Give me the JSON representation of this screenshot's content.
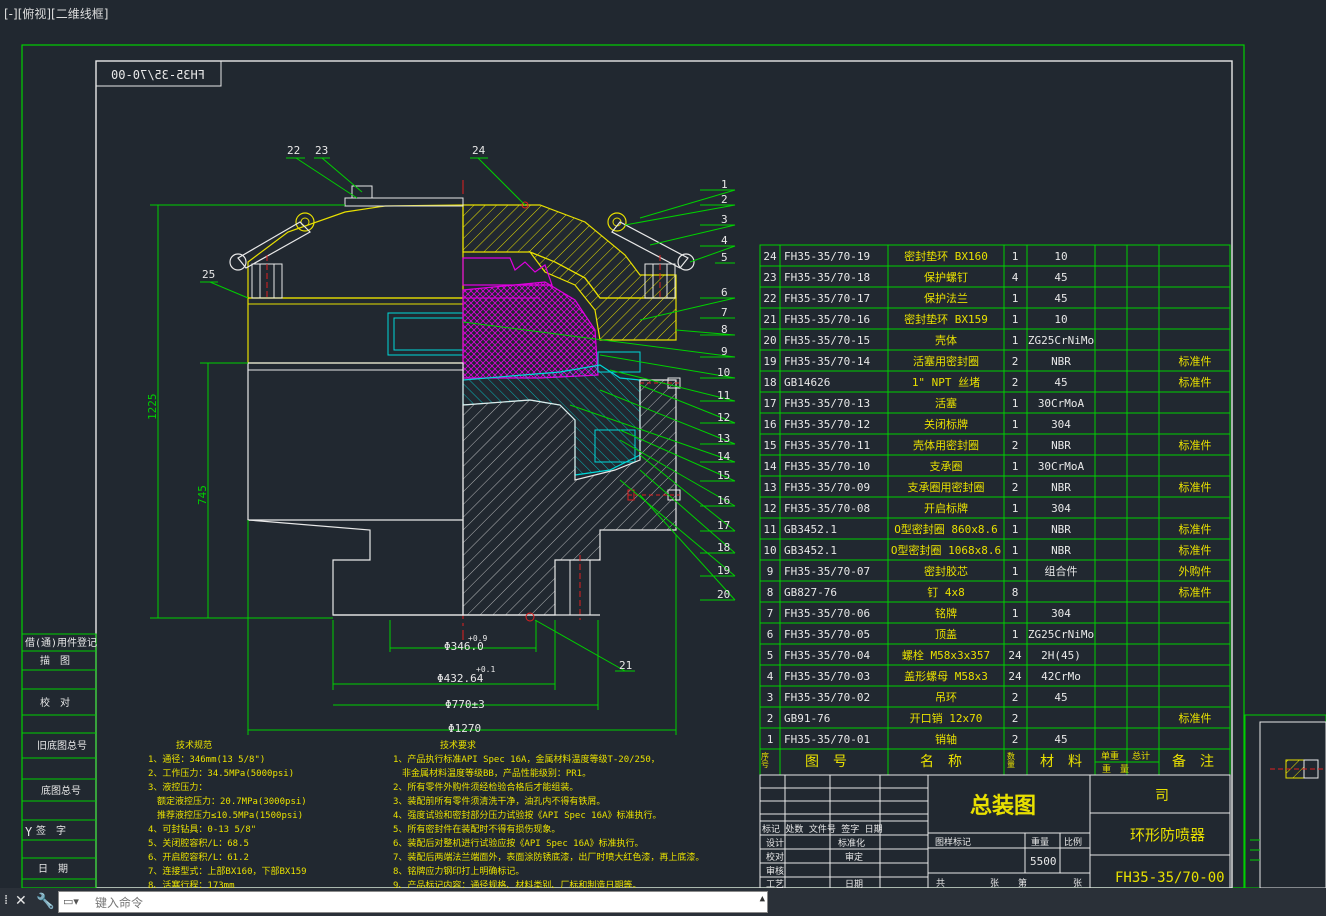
{
  "viewport_label": "[-][俯视][二维线框]",
  "drawing_number_mirrored": "FH35-35/70-00",
  "left_sidebar": {
    "items": [
      "借(通)用件登记",
      "描　图",
      "校　对",
      "旧底图总号",
      "底图总号",
      "签　字",
      "日　期"
    ]
  },
  "balloons": [
    "1",
    "2",
    "3",
    "4",
    "5",
    "6",
    "7",
    "8",
    "9",
    "10",
    "11",
    "12",
    "13",
    "14",
    "15",
    "16",
    "17",
    "18",
    "19",
    "20",
    "21",
    "22",
    "23",
    "24",
    "25"
  ],
  "dimensions": {
    "height_total": "1225",
    "height_lower": "745",
    "dia_346": "Φ346.0",
    "dia_346_tol": "+0.9",
    "dia_432": "Φ432.64",
    "dia_432_tol": "+0.1",
    "dia_770": "Φ770±3",
    "dia_1270": "Φ1270"
  },
  "notes_left": {
    "title": "技术规范",
    "lines": [
      "1、通径：346mm(13 5/8\")",
      "2、工作压力：34.5MPa(5000psi)",
      "3、液控压力：",
      "　额定液控压力：20.7MPa(3000psi)",
      "　推荐液控压力≤10.5MPa(1500psi)",
      "4、可封钻具：0-13 5/8\"",
      "5、关闭腔容积/L：68.5",
      "6、开启腔容积/L：61.2",
      "7、连接型式：上部BX160，下部BX159",
      "8、活塞行程：173mm"
    ]
  },
  "notes_right": {
    "title": "技术要求",
    "lines": [
      "1、产品执行标准API Spec 16A，金属材料温度等级T-20/250，",
      "　非金属材料温度等级BB，产品性能级别：PR1。",
      "2、所有零件外购件须经检验合格后才能组装。",
      "3、装配前所有零件须清洗干净，油孔内不得有铁屑。",
      "4、强度试验和密封部分压力试验按《API Spec 16A》标准执行。",
      "5、所有密封件在装配时不得有损伤现象。",
      "6、装配后对整机进行试验应按《API Spec 16A》标准执行。",
      "7、装配后两端法兰端面外，表面涂防锈底漆，出厂时喷大红色漆，再上底漆。",
      "8、铭牌应力钢印打上明确标记。",
      "9、产品标记内容：通径规格、材料类别、厂标和制造日期等。"
    ]
  },
  "bom": {
    "rows": [
      {
        "no": "24",
        "code": "FH35-35/70-19",
        "name": "密封垫环 BX160",
        "qty": "1",
        "mat": "10",
        "note": ""
      },
      {
        "no": "23",
        "code": "FH35-35/70-18",
        "name": "保护螺钉",
        "qty": "4",
        "mat": "45",
        "note": ""
      },
      {
        "no": "22",
        "code": "FH35-35/70-17",
        "name": "保护法兰",
        "qty": "1",
        "mat": "45",
        "note": ""
      },
      {
        "no": "21",
        "code": "FH35-35/70-16",
        "name": "密封垫环 BX159",
        "qty": "1",
        "mat": "10",
        "note": ""
      },
      {
        "no": "20",
        "code": "FH35-35/70-15",
        "name": "壳体",
        "qty": "1",
        "mat": "ZG25CrNiMo",
        "note": ""
      },
      {
        "no": "19",
        "code": "FH35-35/70-14",
        "name": "活塞用密封圈",
        "qty": "2",
        "mat": "NBR",
        "note": "标准件"
      },
      {
        "no": "18",
        "code": "GB14626",
        "name": "1\" NPT 丝堵",
        "qty": "2",
        "mat": "45",
        "note": "标准件"
      },
      {
        "no": "17",
        "code": "FH35-35/70-13",
        "name": "活塞",
        "qty": "1",
        "mat": "30CrMoA",
        "note": ""
      },
      {
        "no": "16",
        "code": "FH35-35/70-12",
        "name": "关闭标牌",
        "qty": "1",
        "mat": "304",
        "note": ""
      },
      {
        "no": "15",
        "code": "FH35-35/70-11",
        "name": "壳体用密封圈",
        "qty": "2",
        "mat": "NBR",
        "note": "标准件"
      },
      {
        "no": "14",
        "code": "FH35-35/70-10",
        "name": "支承圈",
        "qty": "1",
        "mat": "30CrMoA",
        "note": ""
      },
      {
        "no": "13",
        "code": "FH35-35/70-09",
        "name": "支承圈用密封圈",
        "qty": "2",
        "mat": "NBR",
        "note": "标准件"
      },
      {
        "no": "12",
        "code": "FH35-35/70-08",
        "name": "开启标牌",
        "qty": "1",
        "mat": "304",
        "note": ""
      },
      {
        "no": "11",
        "code": "GB3452.1",
        "name": "O型密封圈 860x8.6",
        "qty": "1",
        "mat": "NBR",
        "note": "标准件"
      },
      {
        "no": "10",
        "code": "GB3452.1",
        "name": "O型密封圈 1068x8.6",
        "qty": "1",
        "mat": "NBR",
        "note": "标准件"
      },
      {
        "no": "9",
        "code": "FH35-35/70-07",
        "name": "密封胶芯",
        "qty": "1",
        "mat": "组合件",
        "note": "外购件"
      },
      {
        "no": "8",
        "code": "GB827-76",
        "name": "钉 4x8",
        "qty": "8",
        "mat": "",
        "note": "标准件"
      },
      {
        "no": "7",
        "code": "FH35-35/70-06",
        "name": "铭牌",
        "qty": "1",
        "mat": "304",
        "note": ""
      },
      {
        "no": "6",
        "code": "FH35-35/70-05",
        "name": "顶盖",
        "qty": "1",
        "mat": "ZG25CrNiMo",
        "note": ""
      },
      {
        "no": "5",
        "code": "FH35-35/70-04",
        "name": "螺栓 M58x3x357",
        "qty": "24",
        "mat": "2H(45)",
        "note": ""
      },
      {
        "no": "4",
        "code": "FH35-35/70-03",
        "name": "盖形螺母 M58x3",
        "qty": "24",
        "mat": "42CrMo",
        "note": ""
      },
      {
        "no": "3",
        "code": "FH35-35/70-02",
        "name": "吊环",
        "qty": "2",
        "mat": "45",
        "note": ""
      },
      {
        "no": "2",
        "code": "GB91-76",
        "name": "开口销 12x70",
        "qty": "2",
        "mat": "",
        "note": "标准件"
      },
      {
        "no": "1",
        "code": "FH35-35/70-01",
        "name": "销轴",
        "qty": "2",
        "mat": "45",
        "note": ""
      }
    ],
    "header": {
      "no": "序号",
      "code": "图　号",
      "name": "名　称",
      "qty": "数量",
      "mat": "材　料",
      "w1": "单重",
      "w2": "总计",
      "weight": "重　量",
      "note": "备　注"
    }
  },
  "title_block": {
    "title": "总装图",
    "company": "司",
    "product": "环形防喷器",
    "drawing_no": "FH35-35/70-00",
    "weight": "5500",
    "labels": {
      "std": "标准化",
      "review": "审定",
      "design": "设计",
      "check": "校对",
      "audit": "审核",
      "craft": "工艺",
      "date": "日期",
      "stage": "图样标记",
      "mass": "重量",
      "scale": "比例",
      "total": "共",
      "sheet": "张",
      "sheet_no": "第",
      "sheet_no2": "张",
      "rev_head": "标记 处数 文件号 签字 日期"
    }
  },
  "command_line": {
    "placeholder": "键入命令"
  },
  "colors": {
    "green": "#00d000",
    "yellow": "#e8e000",
    "magenta": "#e000e0",
    "cyan": "#00d8d8",
    "red": "#e02020",
    "white": "#e8e8e8",
    "bg": "#212830"
  }
}
